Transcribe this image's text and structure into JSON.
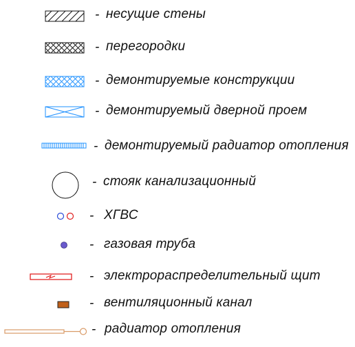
{
  "legend": {
    "separator": "-",
    "items": [
      {
        "id": "walls",
        "label": "несущие стены"
      },
      {
        "id": "partitions",
        "label": "перегородки"
      },
      {
        "id": "dismantled-structures",
        "label": "демонтируемые конструкции"
      },
      {
        "id": "dismantled-doorway",
        "label": "демонтируемый дверной проем"
      },
      {
        "id": "dismantled-radiator",
        "label": "демонтируемый радиатор отопления"
      },
      {
        "id": "sewer-riser",
        "label": "стояк канализационный"
      },
      {
        "id": "hot-cold-water",
        "label": "ХГВС"
      },
      {
        "id": "gas-pipe",
        "label": "газовая труба"
      },
      {
        "id": "electric-panel",
        "label": "электрораспределительный щит"
      },
      {
        "id": "ventilation-duct",
        "label": "вентиляционный канал"
      },
      {
        "id": "radiator",
        "label": "радиатор отопления"
      }
    ]
  },
  "colors": {
    "ink": "#111111",
    "demolition_blue": "#1e90ff",
    "cold_water_blue": "#2a4bd8",
    "hot_water_red": "#e02020",
    "gas_purple": "#6a5acd",
    "electric_red": "#e01010",
    "vent_brown": "#c0601a",
    "radiator_orange": "#d99a66"
  }
}
